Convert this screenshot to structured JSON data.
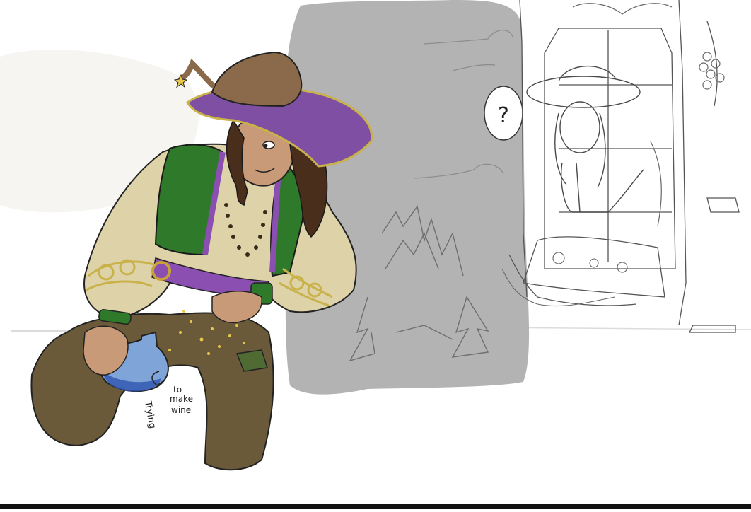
{
  "annotation": {
    "line1": "Trying",
    "line2": "to",
    "line3": "make",
    "line4": "wine"
  },
  "thought_bubble": {
    "symbol": "?"
  },
  "colors": {
    "background": "#ffffff",
    "backdrop_gray": "#b3b3b3",
    "hat_purple": "#7e4fa3",
    "hat_brown": "#8a6a4a",
    "vest_green": "#2f7a2a",
    "shirt_beige": "#ddd2a8",
    "trousers": "#6b5a3a",
    "sash_purple": "#8a4fb0",
    "hair": "#4a2e1c",
    "skin": "#c99a78",
    "potion_blue": "#7fa4d8",
    "bottom_bar": "#111111"
  }
}
